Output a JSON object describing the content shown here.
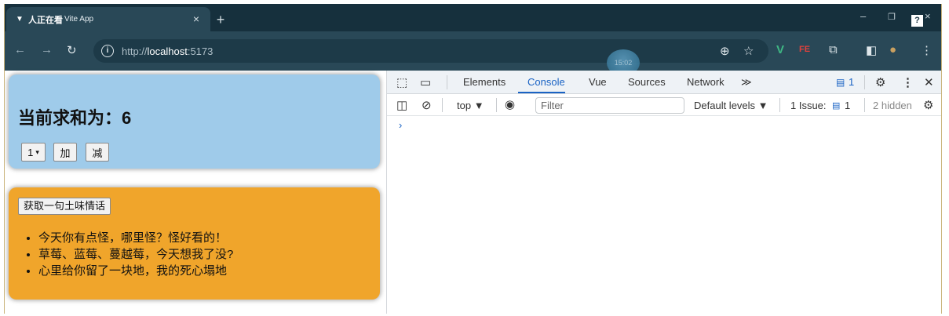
{
  "browser": {
    "tab_favicon_text": "▼",
    "tab_title_prefix": "人正在看",
    "tab_title": "Vite App",
    "tab_close": "×",
    "new_tab": "+",
    "url_scheme_host": "http://",
    "url_host": "localhost",
    "url_port": ":5173",
    "overlay_badge": "15:02"
  },
  "page": {
    "sum_label": "当前求和为：6",
    "step_select_value": "1",
    "add_label": "加",
    "subtract_label": "减",
    "fetch_button_label": "获取一句土味情话",
    "quotes": [
      "今天你有点怪，哪里怪？怪好看的！",
      "草莓、蓝莓、蔓越莓，今天想我了没?",
      "心里给你留了一块地，我的死心塌地"
    ]
  },
  "devtools": {
    "tabs": [
      "Elements",
      "Console",
      "Vue",
      "Sources",
      "Network"
    ],
    "active_tab": "Console",
    "more_tabs": "≫",
    "message_count": "1",
    "context": "top",
    "filter_placeholder": "Filter",
    "levels": "Default levels ▼",
    "issues_label": "1 Issue:",
    "issues_count": "1",
    "hidden_label": "2 hidden",
    "prompt": "›"
  },
  "colors": {
    "card_sum": "#9fcbea",
    "card_quotes": "#f0a52b",
    "devtools_accent": "#1a63c4",
    "browser_chrome": "#294857"
  }
}
